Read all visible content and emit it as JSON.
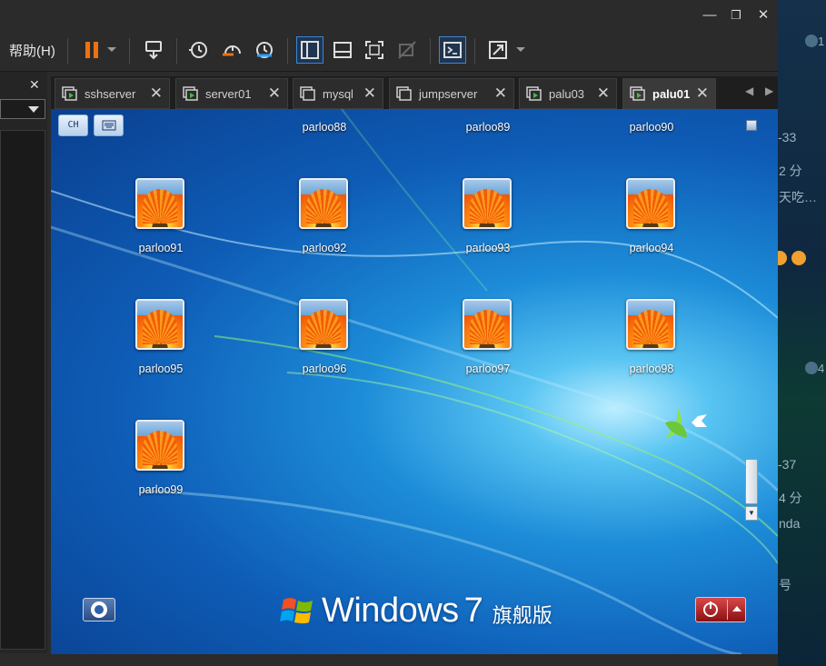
{
  "window": {
    "minimize": "—",
    "maximize": "❐",
    "close": "✕"
  },
  "menu": {
    "help": "帮助(H)"
  },
  "left_panel": {
    "close": "✕"
  },
  "tabs": [
    {
      "label": "sshserver",
      "active": false
    },
    {
      "label": "server01",
      "active": false
    },
    {
      "label": "mysql",
      "active": false
    },
    {
      "label": "jumpserver",
      "active": false
    },
    {
      "label": "palu03",
      "active": false
    },
    {
      "label": "palu01",
      "active": true
    }
  ],
  "tab_close": "✕",
  "tab_nav": {
    "left": "◀",
    "right": "▶"
  },
  "desktop": {
    "ime_lang": "CH",
    "top_row_labels": [
      "parloo88",
      "parloo89",
      "parloo90"
    ],
    "icons": [
      "parloo91",
      "parloo92",
      "parloo93",
      "parloo94",
      "parloo95",
      "parloo96",
      "parloo97",
      "parloo98",
      "parloo99"
    ],
    "brand_word": "Windows",
    "brand_version": "7",
    "brand_edition": "旗舰版"
  },
  "background_app": {
    "lines": [
      "-33",
      "2 分",
      "天吃…",
      "-37",
      "4 分",
      "nda",
      "号"
    ],
    "badges": [
      "1",
      "4"
    ]
  },
  "colors": {
    "toolbar_bg": "#2b2b2b",
    "accent_orange": "#f07010",
    "tab_active_bg": "#3a3a3a",
    "shutdown_red": "#b02020",
    "desktop_blue": "#1d8cd8"
  }
}
